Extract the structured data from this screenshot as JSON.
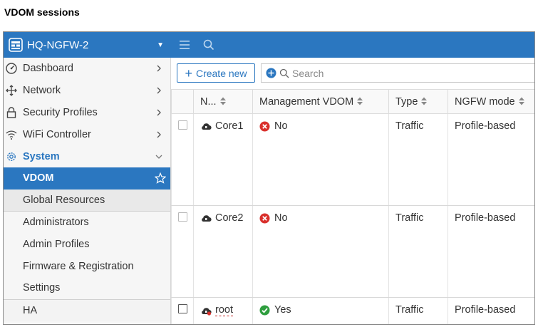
{
  "caption": "VDOM sessions",
  "topbar": {
    "device_name": "HQ-NGFW-2",
    "device_icon": "firewall-device-icon",
    "menu_icon": "hamburger-menu-icon",
    "search_icon": "search-icon"
  },
  "sidebar": {
    "items": [
      {
        "label": "Dashboard",
        "icon": "dashboard-icon"
      },
      {
        "label": "Network",
        "icon": "network-icon"
      },
      {
        "label": "Security Profiles",
        "icon": "lock-icon"
      },
      {
        "label": "WiFi Controller",
        "icon": "wifi-icon"
      },
      {
        "label": "System",
        "icon": "gear-icon"
      }
    ],
    "system_children": [
      {
        "label": "VDOM"
      },
      {
        "label": "Global Resources"
      },
      {
        "label": "Administrators"
      },
      {
        "label": "Admin Profiles"
      },
      {
        "label": "Firmware & Registration"
      },
      {
        "label": "Settings"
      },
      {
        "label": "HA"
      }
    ]
  },
  "toolbar": {
    "create_label": "Create new",
    "search_placeholder": "Search"
  },
  "table": {
    "columns": [
      "N...",
      "Management VDOM",
      "Type",
      "NGFW mode"
    ],
    "rows": [
      {
        "name": "Core1",
        "management": "No",
        "management_status": "no",
        "type": "Traffic",
        "mode": "Profile-based"
      },
      {
        "name": "Core2",
        "management": "No",
        "management_status": "no",
        "type": "Traffic",
        "mode": "Profile-based"
      },
      {
        "name": "root",
        "management": "Yes",
        "management_status": "yes",
        "type": "Traffic",
        "mode": "Profile-based"
      }
    ]
  },
  "colors": {
    "accent": "#2b77c0",
    "no_status": "#d9302c",
    "yes_status": "#2e9e3e"
  }
}
